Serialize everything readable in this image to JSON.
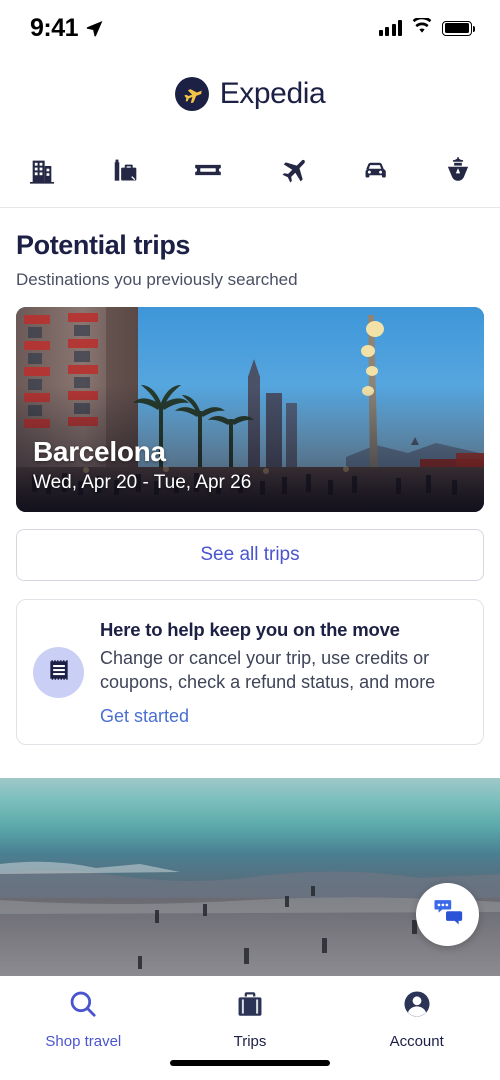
{
  "status_bar": {
    "time": "9:41",
    "location_icon": "location-arrow-icon",
    "signal_icon": "cellular-signal-icon",
    "wifi_icon": "wifi-icon",
    "battery_icon": "battery-full-icon"
  },
  "header": {
    "logo_icon": "expedia-plane-logo",
    "brand_name": "Expedia"
  },
  "lob_nav": {
    "items": [
      {
        "name": "hotels",
        "icon": "hotel-building-icon"
      },
      {
        "name": "packages",
        "icon": "luggage-bags-icon"
      },
      {
        "name": "things-to-do",
        "icon": "ticket-icon"
      },
      {
        "name": "flights",
        "icon": "airplane-icon"
      },
      {
        "name": "cars",
        "icon": "car-icon"
      },
      {
        "name": "cruises",
        "icon": "cruise-ship-icon"
      }
    ]
  },
  "main": {
    "section_title": "Potential trips",
    "section_subtitle": "Destinations you previously searched",
    "trip_card": {
      "city": "Barcelona",
      "dates": "Wed, Apr 20 - Tue, Apr 26",
      "image_alt": "barcelona-dusk-promenade-photo"
    },
    "see_all_label": "See all trips",
    "help_card": {
      "badge_icon": "receipt-icon",
      "title": "Here to help keep you on the move",
      "description": "Change or cancel your trip, use credits or coupons, check a refund status, and more",
      "link_label": "Get started"
    },
    "hero_image_alt": "beach-ocean-photo",
    "chat_fab_icon": "chat-bubbles-icon",
    "cursor_indicator": "touch-cursor-dot"
  },
  "tab_bar": {
    "items": [
      {
        "label": "Shop travel",
        "icon": "search-icon",
        "active": true
      },
      {
        "label": "Trips",
        "icon": "suitcase-icon",
        "active": false
      },
      {
        "label": "Account",
        "icon": "person-avatar-icon",
        "active": false
      }
    ]
  },
  "colors": {
    "brand_navy": "#1c2045",
    "brand_yellow": "#f6c445",
    "accent_blue": "#4a54cf",
    "link_blue": "#4a6fd0",
    "badge_lavender": "#c9cff5",
    "chat_blue": "#2a53d6",
    "border_gray": "#e0e2e8"
  }
}
